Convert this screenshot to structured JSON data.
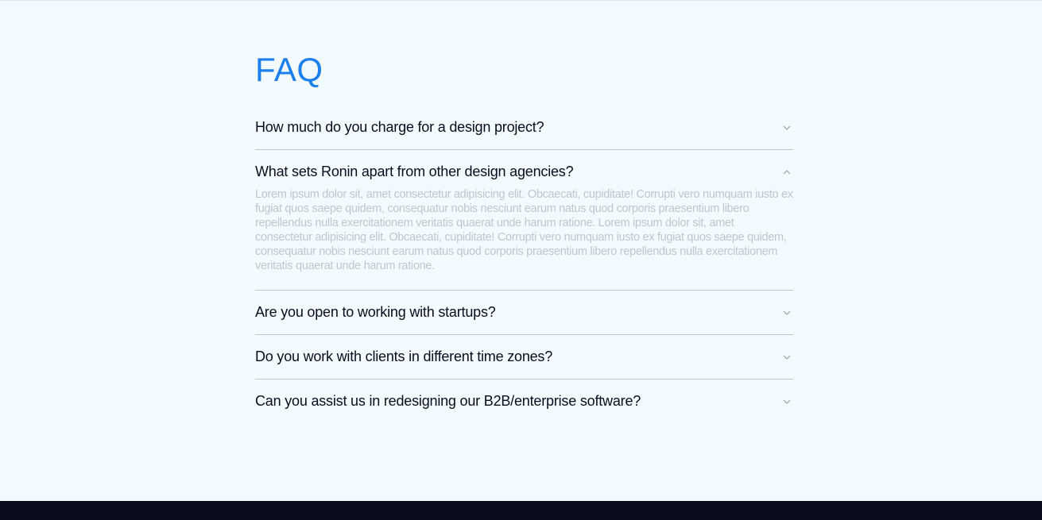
{
  "faq": {
    "title": "FAQ",
    "items": [
      {
        "question": "How much do you charge for a design project?",
        "expanded": false,
        "chevron": "chevron-down-icon"
      },
      {
        "question": "What sets Ronin apart from other design agencies?",
        "expanded": true,
        "chevron": "chevron-up-icon",
        "answer": "Lorem ipsum dolor sit, amet consectetur adipisicing elit. Obcaecati, cupiditate! Corrupti vero numquam iusto ex fugiat quos saepe quidem, consequatur nobis nesciunt earum natus quod corporis praesentium libero repellendus nulla exercitationem veritatis quaerat unde harum ratione. Lorem ipsum dolor sit, amet consectetur adipisicing elit. Obcaecati, cupiditate! Corrupti vero numquam iusto ex fugiat quos saepe quidem, consequatur nobis nesciunt earum natus quod corporis praesentium libero repellendus nulla exercitationem veritatis quaerat unde harum ratione."
      },
      {
        "question": "Are you open to working with startups?",
        "expanded": false,
        "chevron": "chevron-down-icon"
      },
      {
        "question": "Do you work with clients in different time zones?",
        "expanded": false,
        "chevron": "chevron-down-icon"
      },
      {
        "question": "Can you assist us in redesigning our B2B/enterprise software?",
        "expanded": false,
        "chevron": "chevron-down-icon"
      }
    ]
  },
  "colors": {
    "background": "#f3fafd",
    "accent": "#1d7fec",
    "question_text": "#0b0d1f",
    "answer_text": "#c1c6cc",
    "divider": "#c3c6c9",
    "chevron": "#9aa1a8",
    "footer": "#090a1e"
  }
}
